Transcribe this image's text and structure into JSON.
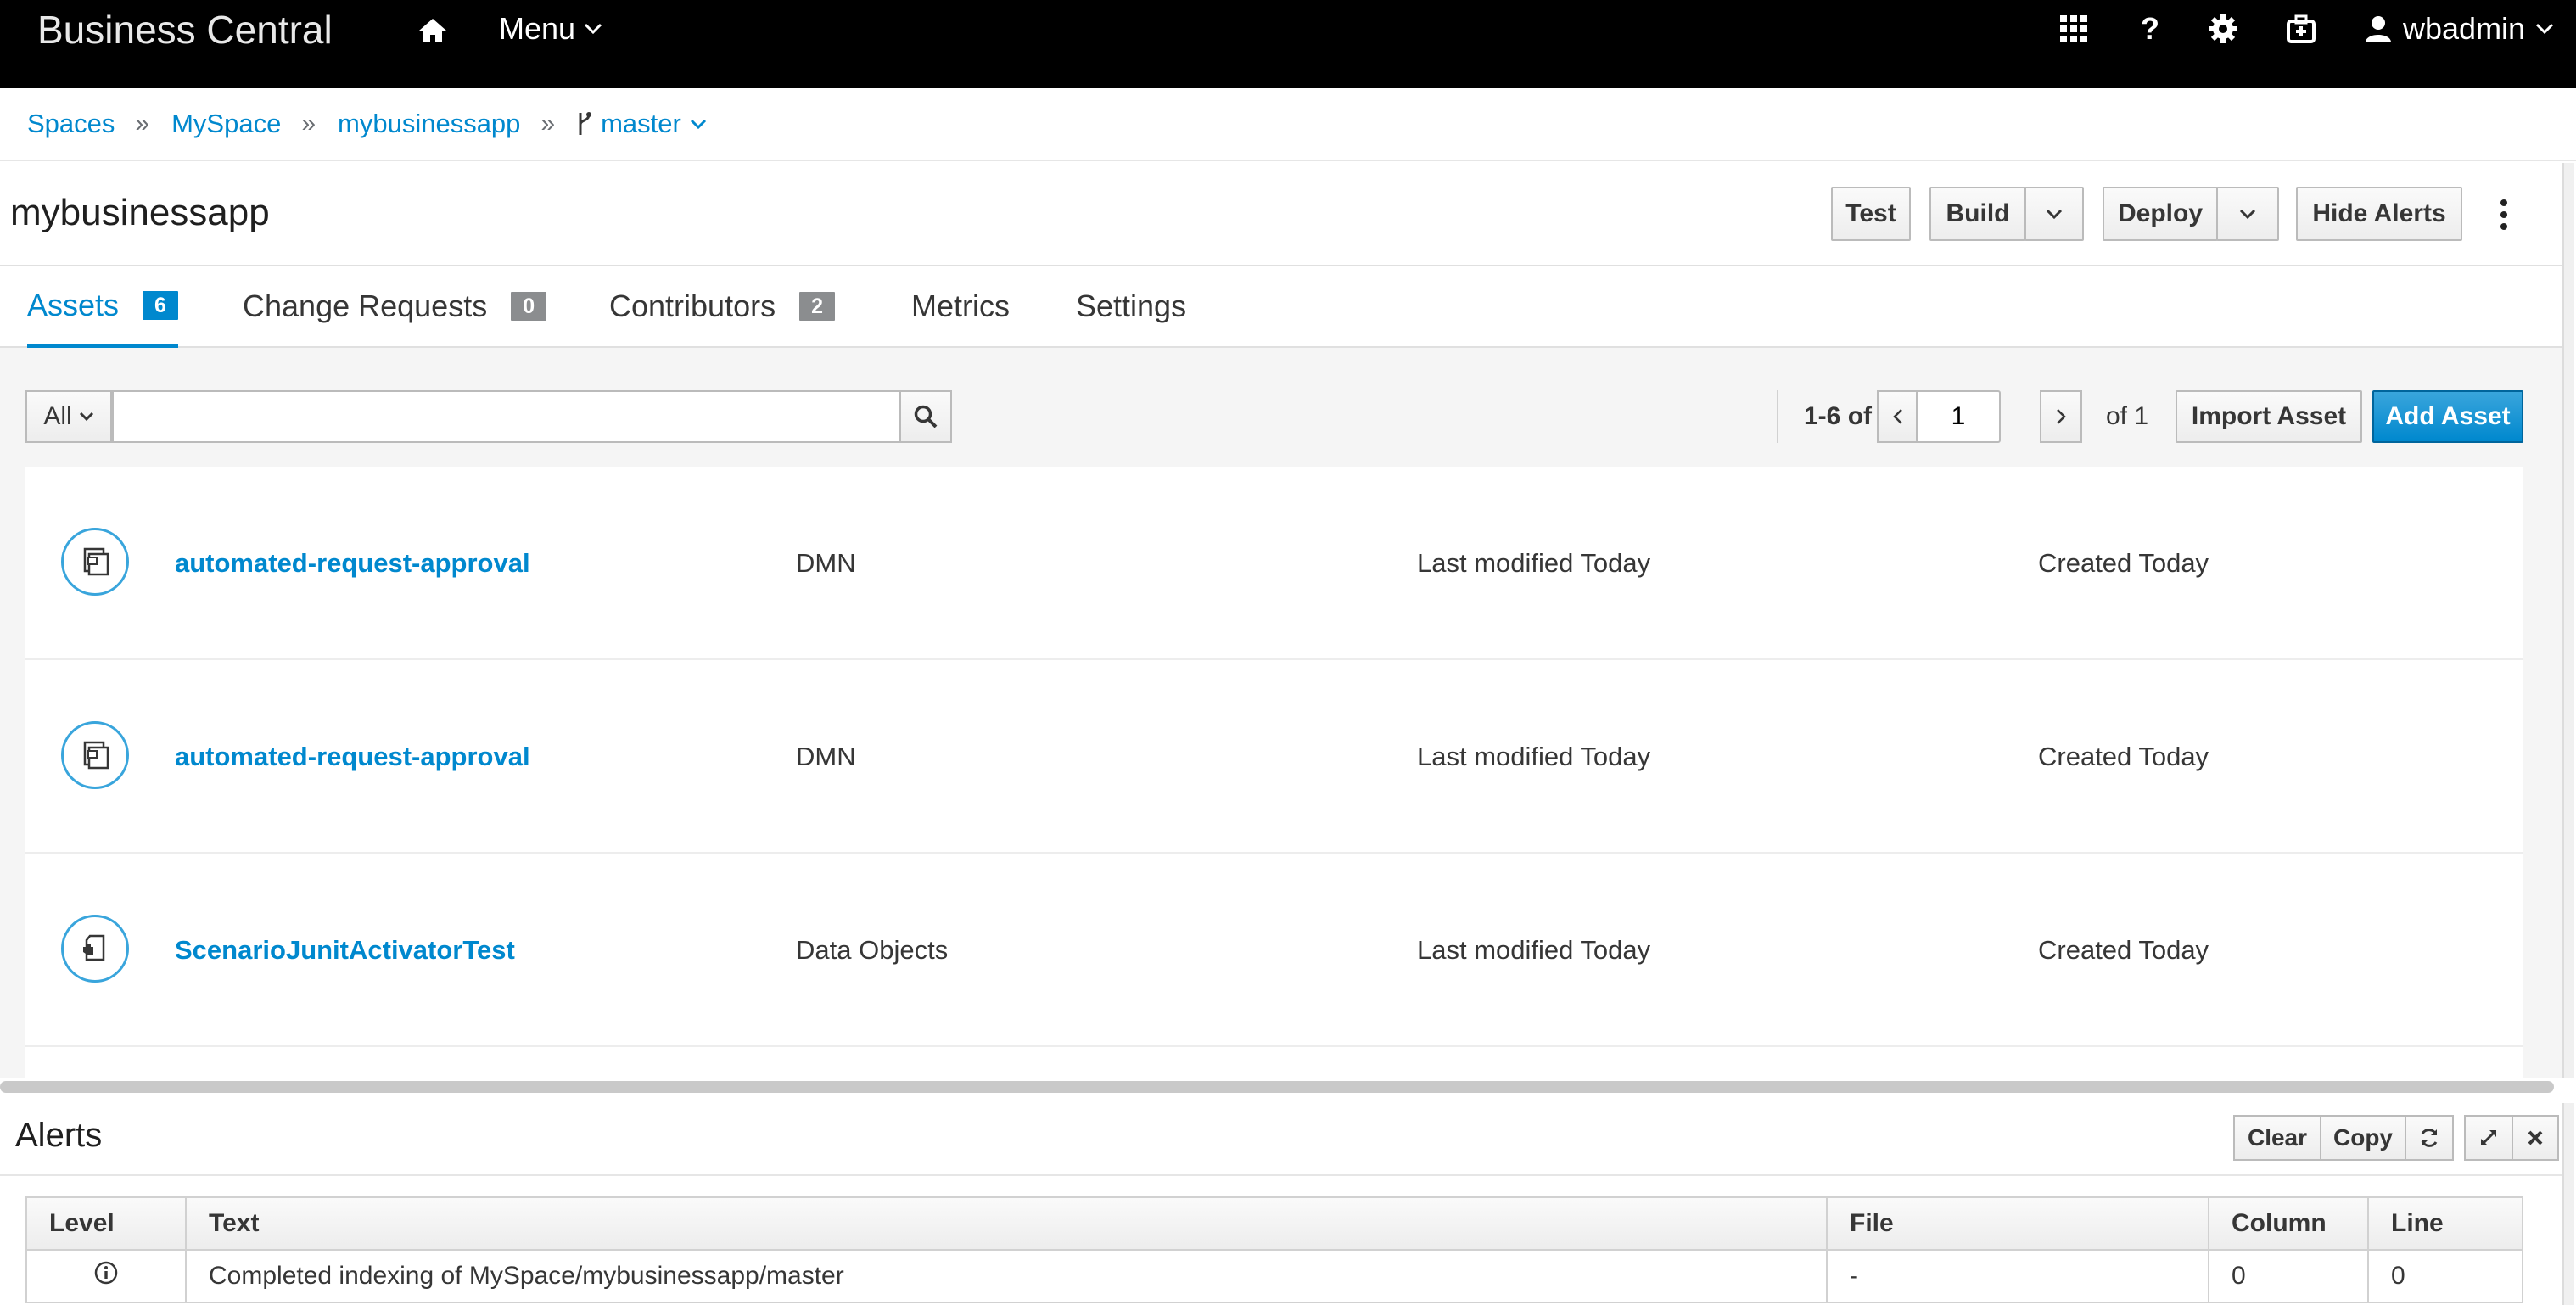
{
  "app": {
    "brand": "Business Central",
    "menu_label": "Menu",
    "user": "wbadmin",
    "help_glyph": "?"
  },
  "breadcrumb": {
    "items": [
      "Spaces",
      "MySpace",
      "mybusinessapp"
    ],
    "separator": "»",
    "branch": "master"
  },
  "project": {
    "title": "mybusinessapp",
    "buttons": {
      "test": "Test",
      "build": "Build",
      "deploy": "Deploy",
      "hide_alerts": "Hide Alerts"
    }
  },
  "tabs": [
    {
      "label": "Assets",
      "count": "6",
      "active": true
    },
    {
      "label": "Change Requests",
      "count": "0"
    },
    {
      "label": "Contributors",
      "count": "2"
    },
    {
      "label": "Metrics"
    },
    {
      "label": "Settings"
    }
  ],
  "toolbar": {
    "filter": "All",
    "search_value": "",
    "search_placeholder": "",
    "range": "1-6 of 6",
    "page": "1",
    "of_pages": "of 1",
    "import_label": "Import Asset",
    "add_label": "Add Asset"
  },
  "assets": [
    {
      "name": "automated-request-approval",
      "type": "DMN",
      "modified": "Last modified Today",
      "created": "Created Today",
      "icon": "dmn-asset-icon"
    },
    {
      "name": "automated-request-approval",
      "type": "DMN",
      "modified": "Last modified Today",
      "created": "Created Today",
      "icon": "dmn-asset-icon"
    },
    {
      "name": "ScenarioJunitActivatorTest",
      "type": "Data Objects",
      "modified": "Last modified Today",
      "created": "Created Today",
      "icon": "data-object-asset-icon"
    }
  ],
  "alerts": {
    "title": "Alerts",
    "clear": "Clear",
    "copy": "Copy",
    "columns": [
      "Level",
      "Text",
      "File",
      "Column",
      "Line"
    ],
    "rows": [
      {
        "level_icon": "info-icon",
        "text": "Completed indexing of MySpace/mybusinessapp/master",
        "file": "-",
        "column": "0",
        "line": "0"
      }
    ]
  },
  "colors": {
    "accent": "#0088ce",
    "navbar": "#000000",
    "badge_inactive": "#8b8d8f"
  }
}
